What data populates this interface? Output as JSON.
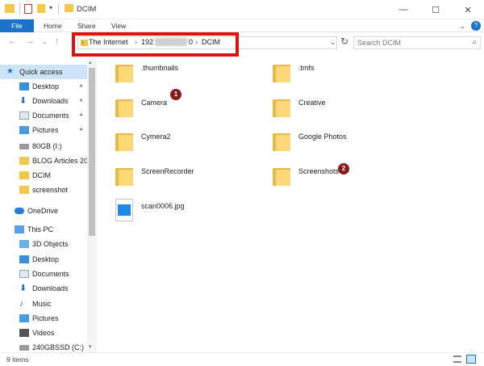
{
  "window": {
    "title": "DCIM",
    "minimize": "—",
    "maximize": "☐",
    "close": "✕"
  },
  "ribbon": {
    "tabs": [
      "File",
      "Home",
      "Share",
      "View"
    ]
  },
  "address": {
    "crumbs": [
      "The Internet",
      "192",
      "0",
      "DCIM"
    ],
    "search_placeholder": "Search DCIM"
  },
  "sidebar": {
    "items": [
      {
        "label": "Quick access"
      },
      {
        "label": "Desktop"
      },
      {
        "label": "Downloads"
      },
      {
        "label": "Documents"
      },
      {
        "label": "Pictures"
      },
      {
        "label": "80GB (I:)"
      },
      {
        "label": "BLOG Articles 20"
      },
      {
        "label": "DCIM"
      },
      {
        "label": "screenshot"
      },
      {
        "label": "OneDrive"
      },
      {
        "label": "This PC"
      },
      {
        "label": "3D Objects"
      },
      {
        "label": "Desktop"
      },
      {
        "label": "Documents"
      },
      {
        "label": "Downloads"
      },
      {
        "label": "Music"
      },
      {
        "label": "Pictures"
      },
      {
        "label": "Videos"
      },
      {
        "label": "240GBSSD (C:)"
      }
    ]
  },
  "files": [
    {
      "name": ".thumbnails"
    },
    {
      "name": ".tmfs"
    },
    {
      "name": "Camera"
    },
    {
      "name": "Creative"
    },
    {
      "name": "Cymera2"
    },
    {
      "name": "Google Photos"
    },
    {
      "name": "ScreenRecorder"
    },
    {
      "name": "Screenshots"
    },
    {
      "name": "scan0006.jpg"
    }
  ],
  "badges": [
    "1",
    "2"
  ],
  "status": {
    "item_count": "9 items"
  },
  "colors": {
    "accent": "#1a73c8",
    "highlight": "#e01010",
    "badge": "#8b1a1a",
    "folder": "#fcd878"
  }
}
